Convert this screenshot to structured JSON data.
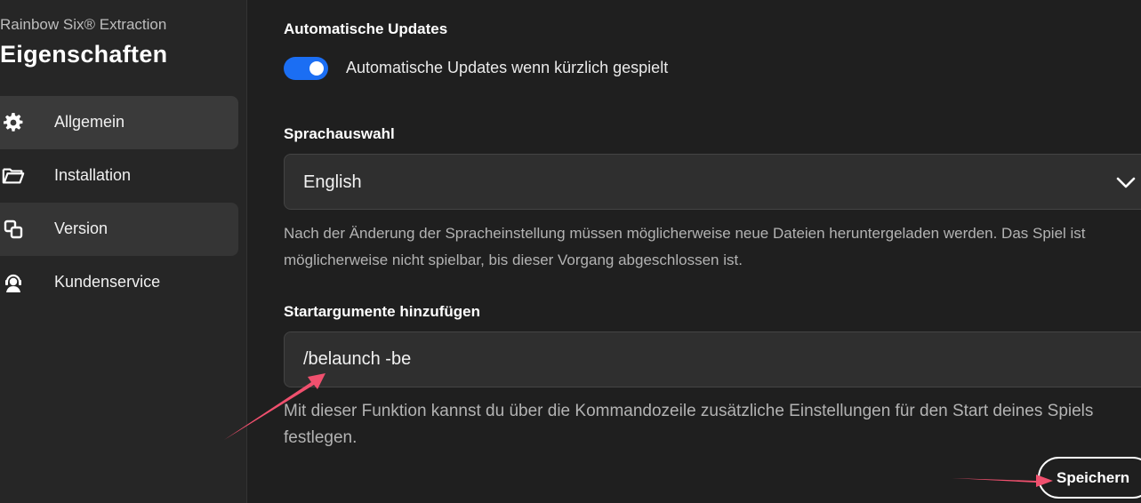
{
  "sidebar": {
    "game_title": "Rainbow Six® Extraction",
    "page_heading": "Eigenschaften",
    "items": [
      {
        "label": "Allgemein",
        "icon": "gear-icon",
        "state": "active"
      },
      {
        "label": "Installation",
        "icon": "folder-icon",
        "state": "normal"
      },
      {
        "label": "Version",
        "icon": "version-icon",
        "state": "hover"
      },
      {
        "label": "Kundenservice",
        "icon": "support-agent-icon",
        "state": "normal"
      }
    ]
  },
  "auto_updates": {
    "title": "Automatische Updates",
    "toggle_label": "Automatische Updates wenn kürzlich gespielt",
    "enabled": true
  },
  "language": {
    "title": "Sprachauswahl",
    "selected": "English",
    "help": "Nach der Änderung der Spracheinstellung müssen möglicherweise neue Dateien heruntergeladen werden. Das Spiel ist möglicherweise nicht spielbar, bis dieser Vorgang abgeschlossen ist."
  },
  "launch_args": {
    "title": "Startargumente hinzufügen",
    "value": "/belaunch -be",
    "help": "Mit dieser Funktion kannst du über die Kommandozeile zusätzliche Einstellungen für den Start deines Spiels festlegen."
  },
  "actions": {
    "save_label": "Speichern"
  },
  "colors": {
    "accent": "#1b6ef3",
    "annotation_arrow": "#f0506e"
  }
}
